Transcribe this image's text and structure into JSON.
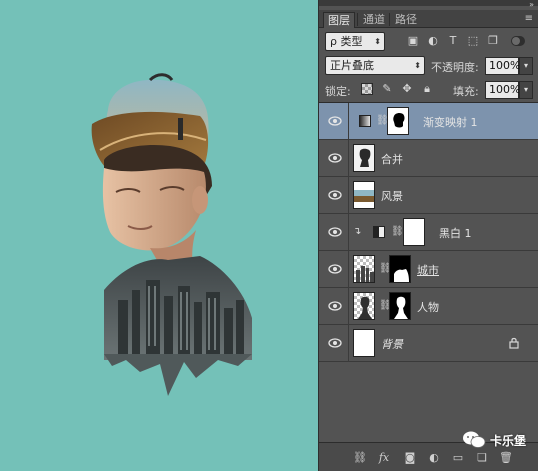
{
  "panel": {
    "tabs": [
      "图层",
      "通道",
      "路径"
    ],
    "active_tab": 0,
    "filter": {
      "label": "ρ 类型"
    },
    "blend_mode": "正片叠底",
    "opacity": {
      "label": "不透明度:",
      "value": "100%"
    },
    "lock": {
      "label": "锁定:"
    },
    "fill": {
      "label": "填充:",
      "value": "100%"
    }
  },
  "layers": [
    {
      "name": "渐变映射 1",
      "selected": true,
      "type": "adjustment-gradient-map",
      "has_mask": true
    },
    {
      "name": "合并",
      "selected": false,
      "type": "pixel"
    },
    {
      "name": "风景",
      "selected": false,
      "type": "pixel"
    },
    {
      "name": "黑白 1",
      "selected": false,
      "type": "adjustment-black-white",
      "clipped": true,
      "has_mask": true
    },
    {
      "name": "城市",
      "selected": false,
      "type": "pixel",
      "has_mask": true
    },
    {
      "name": "人物",
      "selected": false,
      "type": "pixel",
      "has_mask": true
    },
    {
      "name": "背景",
      "selected": false,
      "type": "background",
      "locked": true
    }
  ],
  "colors": {
    "canvas_bg": "#74c1b8",
    "panel_bg": "#535353",
    "selected_layer": "#7d93ad"
  },
  "watermark": {
    "text": "卡乐堡"
  }
}
